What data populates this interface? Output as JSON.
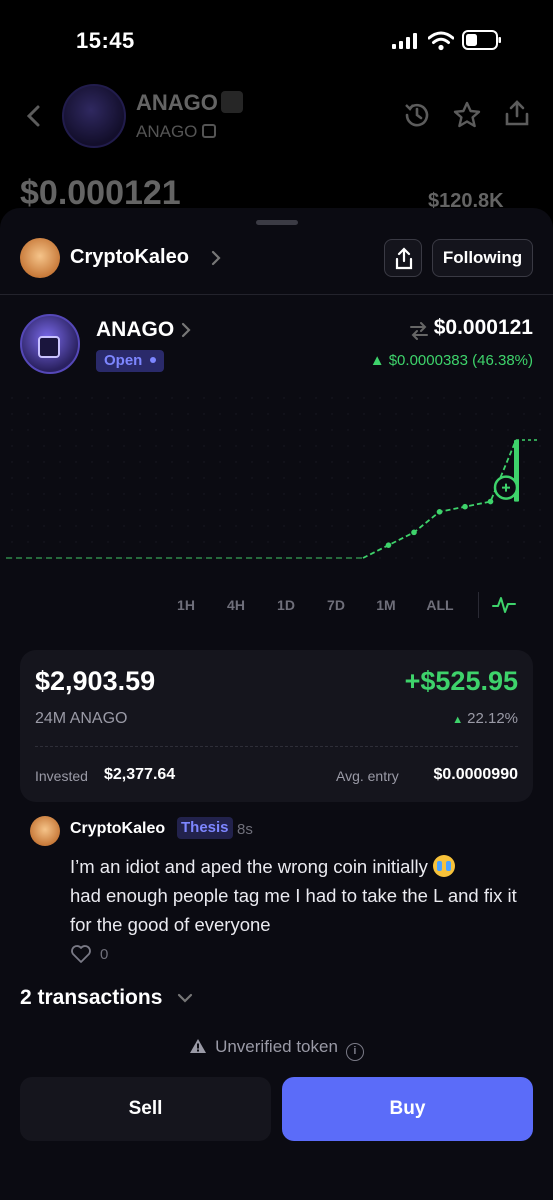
{
  "status_bar": {
    "time": "15:45"
  },
  "background_header": {
    "token_name": "ANAGO",
    "ticker": "ANAGO",
    "price": "$0.000121",
    "volume": "$120.8K"
  },
  "poster": {
    "name": "CryptoKaleo",
    "follow_label": "Following"
  },
  "token": {
    "name": "ANAGO",
    "status": "Open",
    "price": "$0.000121",
    "change": "▲ $0.0000383 (46.38%)"
  },
  "chart_data": {
    "type": "line",
    "series": [
      {
        "values": [
          1,
          1,
          1,
          1,
          1,
          1,
          1,
          1,
          1,
          1,
          1,
          1,
          1,
          1,
          1,
          1.05,
          1.1,
          1.18,
          1.2,
          1.22,
          1.46
        ]
      }
    ],
    "grid": true,
    "colors": {
      "line": "#3ed36b",
      "dash_flat": "#2f8a4a",
      "marker": "#3ed36b"
    }
  },
  "ranges": {
    "items": [
      "1H",
      "4H",
      "1D",
      "7D",
      "1M",
      "ALL"
    ],
    "active": "1H"
  },
  "position": {
    "value": "$2,903.59",
    "pnl": "+$525.95",
    "quantity": "24M ANAGO",
    "pnl_pct": "22.12%",
    "invested_label": "Invested",
    "invested_value": "$2,377.64",
    "avg_label": "Avg. entry",
    "avg_value": "$0.0000990"
  },
  "comment": {
    "author": "CryptoKaleo",
    "tag": "Thesis",
    "time": "8s",
    "text_1": "I’m an idiot and aped the wrong coin initially ",
    "text_2": "had enough people tag me I had to take the L and fix it for the good of everyone",
    "likes": "0"
  },
  "transactions": {
    "label": "2 transactions"
  },
  "warning": {
    "label": "Unverified token"
  },
  "actions": {
    "sell": "Sell",
    "buy": "Buy"
  },
  "colors": {
    "accent": "#5b6cf9",
    "positive": "#3ed36b",
    "background": "#0b0b12",
    "card": "#15151d"
  }
}
